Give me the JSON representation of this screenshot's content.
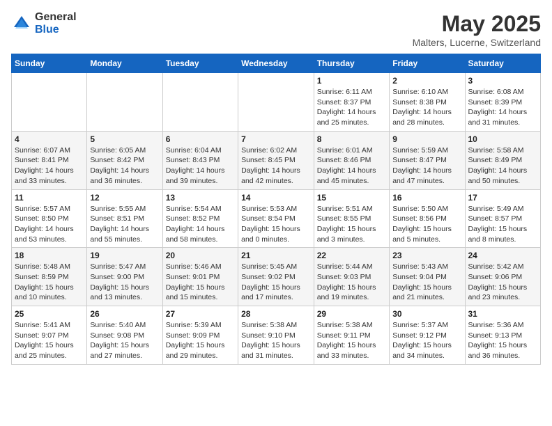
{
  "header": {
    "logo_general": "General",
    "logo_blue": "Blue",
    "month_title": "May 2025",
    "location": "Malters, Lucerne, Switzerland"
  },
  "days_of_week": [
    "Sunday",
    "Monday",
    "Tuesday",
    "Wednesday",
    "Thursday",
    "Friday",
    "Saturday"
  ],
  "weeks": [
    [
      {
        "num": "",
        "info": ""
      },
      {
        "num": "",
        "info": ""
      },
      {
        "num": "",
        "info": ""
      },
      {
        "num": "",
        "info": ""
      },
      {
        "num": "1",
        "info": "Sunrise: 6:11 AM\nSunset: 8:37 PM\nDaylight: 14 hours\nand 25 minutes."
      },
      {
        "num": "2",
        "info": "Sunrise: 6:10 AM\nSunset: 8:38 PM\nDaylight: 14 hours\nand 28 minutes."
      },
      {
        "num": "3",
        "info": "Sunrise: 6:08 AM\nSunset: 8:39 PM\nDaylight: 14 hours\nand 31 minutes."
      }
    ],
    [
      {
        "num": "4",
        "info": "Sunrise: 6:07 AM\nSunset: 8:41 PM\nDaylight: 14 hours\nand 33 minutes."
      },
      {
        "num": "5",
        "info": "Sunrise: 6:05 AM\nSunset: 8:42 PM\nDaylight: 14 hours\nand 36 minutes."
      },
      {
        "num": "6",
        "info": "Sunrise: 6:04 AM\nSunset: 8:43 PM\nDaylight: 14 hours\nand 39 minutes."
      },
      {
        "num": "7",
        "info": "Sunrise: 6:02 AM\nSunset: 8:45 PM\nDaylight: 14 hours\nand 42 minutes."
      },
      {
        "num": "8",
        "info": "Sunrise: 6:01 AM\nSunset: 8:46 PM\nDaylight: 14 hours\nand 45 minutes."
      },
      {
        "num": "9",
        "info": "Sunrise: 5:59 AM\nSunset: 8:47 PM\nDaylight: 14 hours\nand 47 minutes."
      },
      {
        "num": "10",
        "info": "Sunrise: 5:58 AM\nSunset: 8:49 PM\nDaylight: 14 hours\nand 50 minutes."
      }
    ],
    [
      {
        "num": "11",
        "info": "Sunrise: 5:57 AM\nSunset: 8:50 PM\nDaylight: 14 hours\nand 53 minutes."
      },
      {
        "num": "12",
        "info": "Sunrise: 5:55 AM\nSunset: 8:51 PM\nDaylight: 14 hours\nand 55 minutes."
      },
      {
        "num": "13",
        "info": "Sunrise: 5:54 AM\nSunset: 8:52 PM\nDaylight: 14 hours\nand 58 minutes."
      },
      {
        "num": "14",
        "info": "Sunrise: 5:53 AM\nSunset: 8:54 PM\nDaylight: 15 hours\nand 0 minutes."
      },
      {
        "num": "15",
        "info": "Sunrise: 5:51 AM\nSunset: 8:55 PM\nDaylight: 15 hours\nand 3 minutes."
      },
      {
        "num": "16",
        "info": "Sunrise: 5:50 AM\nSunset: 8:56 PM\nDaylight: 15 hours\nand 5 minutes."
      },
      {
        "num": "17",
        "info": "Sunrise: 5:49 AM\nSunset: 8:57 PM\nDaylight: 15 hours\nand 8 minutes."
      }
    ],
    [
      {
        "num": "18",
        "info": "Sunrise: 5:48 AM\nSunset: 8:59 PM\nDaylight: 15 hours\nand 10 minutes."
      },
      {
        "num": "19",
        "info": "Sunrise: 5:47 AM\nSunset: 9:00 PM\nDaylight: 15 hours\nand 13 minutes."
      },
      {
        "num": "20",
        "info": "Sunrise: 5:46 AM\nSunset: 9:01 PM\nDaylight: 15 hours\nand 15 minutes."
      },
      {
        "num": "21",
        "info": "Sunrise: 5:45 AM\nSunset: 9:02 PM\nDaylight: 15 hours\nand 17 minutes."
      },
      {
        "num": "22",
        "info": "Sunrise: 5:44 AM\nSunset: 9:03 PM\nDaylight: 15 hours\nand 19 minutes."
      },
      {
        "num": "23",
        "info": "Sunrise: 5:43 AM\nSunset: 9:04 PM\nDaylight: 15 hours\nand 21 minutes."
      },
      {
        "num": "24",
        "info": "Sunrise: 5:42 AM\nSunset: 9:06 PM\nDaylight: 15 hours\nand 23 minutes."
      }
    ],
    [
      {
        "num": "25",
        "info": "Sunrise: 5:41 AM\nSunset: 9:07 PM\nDaylight: 15 hours\nand 25 minutes."
      },
      {
        "num": "26",
        "info": "Sunrise: 5:40 AM\nSunset: 9:08 PM\nDaylight: 15 hours\nand 27 minutes."
      },
      {
        "num": "27",
        "info": "Sunrise: 5:39 AM\nSunset: 9:09 PM\nDaylight: 15 hours\nand 29 minutes."
      },
      {
        "num": "28",
        "info": "Sunrise: 5:38 AM\nSunset: 9:10 PM\nDaylight: 15 hours\nand 31 minutes."
      },
      {
        "num": "29",
        "info": "Sunrise: 5:38 AM\nSunset: 9:11 PM\nDaylight: 15 hours\nand 33 minutes."
      },
      {
        "num": "30",
        "info": "Sunrise: 5:37 AM\nSunset: 9:12 PM\nDaylight: 15 hours\nand 34 minutes."
      },
      {
        "num": "31",
        "info": "Sunrise: 5:36 AM\nSunset: 9:13 PM\nDaylight: 15 hours\nand 36 minutes."
      }
    ]
  ]
}
